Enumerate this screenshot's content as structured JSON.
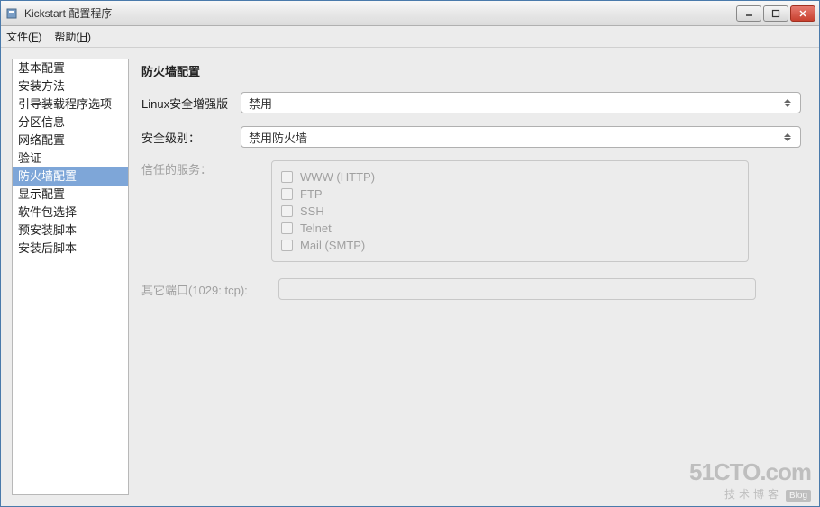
{
  "window": {
    "title": "Kickstart 配置程序"
  },
  "menubar": {
    "file": "文件(F)",
    "help": "帮助(H)"
  },
  "sidebar": {
    "items": [
      {
        "label": "基本配置"
      },
      {
        "label": "安装方法"
      },
      {
        "label": "引导装载程序选项"
      },
      {
        "label": "分区信息"
      },
      {
        "label": "网络配置"
      },
      {
        "label": "验证"
      },
      {
        "label": "防火墙配置",
        "selected": true
      },
      {
        "label": "显示配置"
      },
      {
        "label": "软件包选择"
      },
      {
        "label": "预安装脚本"
      },
      {
        "label": "安装后脚本"
      }
    ]
  },
  "main": {
    "title": "防火墙配置",
    "selinux_label": "Linux安全增强版",
    "selinux_value": "禁用",
    "level_label": "安全级别：",
    "level_value": "禁用防火墙",
    "services_label": "信任的服务：",
    "services": [
      "WWW (HTTP)",
      "FTP",
      "SSH",
      "Telnet",
      "Mail (SMTP)"
    ],
    "other_ports_label": "其它端口(1029: tcp):",
    "other_ports_value": ""
  },
  "watermark": {
    "big": "51CTO.com",
    "small": "技术博客",
    "blog": "Blog"
  }
}
